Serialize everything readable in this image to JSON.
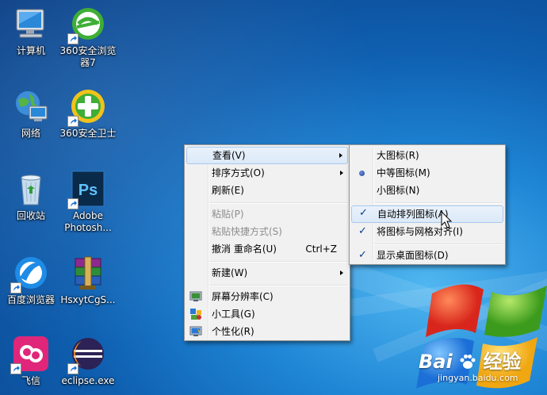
{
  "desktop_icons": [
    {
      "label": "计算机",
      "icon": "computer-icon",
      "shortcut": false
    },
    {
      "label": "360安全浏览器7",
      "icon": "360-browser-icon",
      "shortcut": true
    },
    {
      "label": "网络",
      "icon": "network-icon",
      "shortcut": false
    },
    {
      "label": "360安全卫士",
      "icon": "360-safe-guard-icon",
      "shortcut": true
    },
    {
      "label": "回收站",
      "icon": "recycle-bin-icon",
      "shortcut": false
    },
    {
      "label": "Adobe Photosh...",
      "icon": "photoshop-icon",
      "shortcut": true
    },
    {
      "label": "百度浏览器",
      "icon": "baidu-browser-icon",
      "shortcut": true
    },
    {
      "label": "HsxytCgS...",
      "icon": "winrar-archive-icon",
      "shortcut": false
    },
    {
      "label": "飞信",
      "icon": "fetion-icon",
      "shortcut": true
    },
    {
      "label": "eclipse.exe",
      "icon": "eclipse-icon",
      "shortcut": true
    }
  ],
  "context_menu": {
    "view": "查看(V)",
    "sort_by": "排序方式(O)",
    "refresh": "刷新(E)",
    "paste": "粘贴(P)",
    "paste_shortcut": "粘贴快捷方式(S)",
    "undo_rename": "撤消 重命名(U)",
    "undo_shortcut": "Ctrl+Z",
    "new": "新建(W)",
    "screen_resolution": "屏幕分辨率(C)",
    "gadgets": "小工具(G)",
    "personalize": "个性化(R)"
  },
  "view_submenu": {
    "large_icons": "大图标(R)",
    "medium_icons": "中等图标(M)",
    "small_icons": "小图标(N)",
    "auto_arrange": "自动排列图标(A)",
    "align_to_grid": "将图标与网格对齐(I)",
    "show_desktop_icons": "显示桌面图标(D)",
    "check_mark": "✓",
    "selected_size": "medium"
  },
  "watermark": {
    "brand_left": "Bai",
    "brand_right": "经验",
    "url": "jingyan.baidu.com"
  },
  "colors": {
    "menu_bg": "#f1f1f1",
    "highlight": "#dbe9f8",
    "highlight_border": "#a8c9ee",
    "desktop_blue": "#1f86d6"
  }
}
